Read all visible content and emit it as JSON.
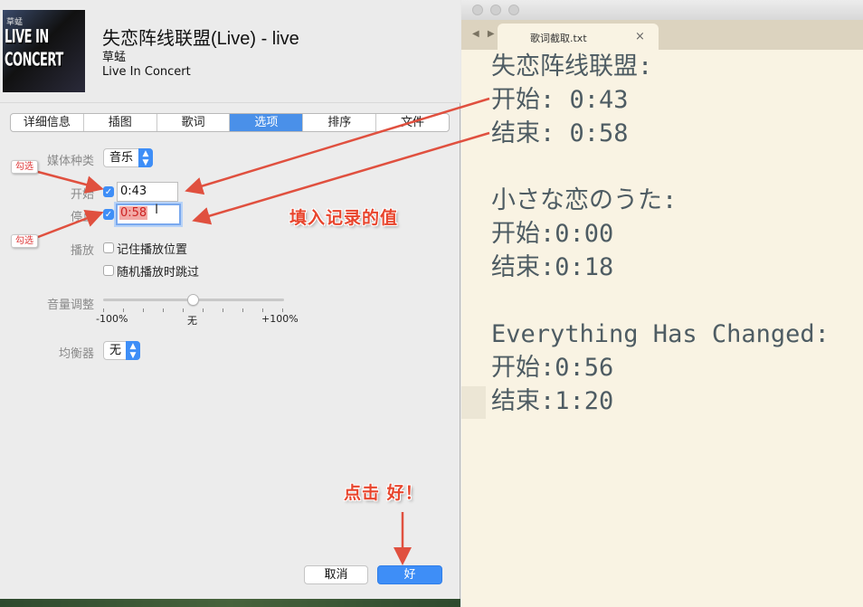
{
  "dialog": {
    "cover": {
      "top_text": "草蜢",
      "logo_text": "LIVE IN CONCERT"
    },
    "song": {
      "title": "失恋阵线联盟(Live) - live",
      "artist": "草蜢",
      "album": "Live In Concert"
    },
    "tabs": [
      {
        "label": "详细信息",
        "active": false
      },
      {
        "label": "插图",
        "active": false
      },
      {
        "label": "歌词",
        "active": false
      },
      {
        "label": "选项",
        "active": true
      },
      {
        "label": "排序",
        "active": false
      },
      {
        "label": "文件",
        "active": false
      }
    ],
    "options": {
      "media_kind_label": "媒体种类",
      "media_kind_value": "音乐",
      "start_label": "开始",
      "start_checked": true,
      "start_value": "0:43",
      "stop_label": "停止",
      "stop_checked": true,
      "stop_value": "0:58",
      "playback_label": "播放",
      "remember_position_label": "记住播放位置",
      "remember_position_checked": false,
      "skip_shuffle_label": "随机播放时跳过",
      "skip_shuffle_checked": false,
      "volume_label": "音量调整",
      "volume_min": "-100%",
      "volume_mid": "无",
      "volume_max": "+100%",
      "volume_level_percent": 0,
      "eq_label": "均衡器",
      "eq_value": "无"
    },
    "buttons": {
      "cancel": "取消",
      "ok": "好"
    },
    "accent_color": "#3e8ef7"
  },
  "annotations": {
    "tag_check_1": "勾选",
    "tag_check_2": "勾选",
    "fill_values": "填入记录的值",
    "click_ok": "点击 好！",
    "arrow_color": "#e0503f"
  },
  "editor": {
    "tab_title": "歌词截取.txt",
    "tab_close": "×",
    "nav_arrows": "◀ ▶",
    "background_color": "#f9f3e3",
    "lines": [
      "失恋阵线联盟:",
      "开始: 0:43",
      "结束: 0:58",
      "",
      "小さな恋のうた:",
      "开始:0:00",
      "结束:0:18",
      "",
      "Everything Has Changed:",
      "开始:0:56",
      "结束:1:20"
    ]
  }
}
